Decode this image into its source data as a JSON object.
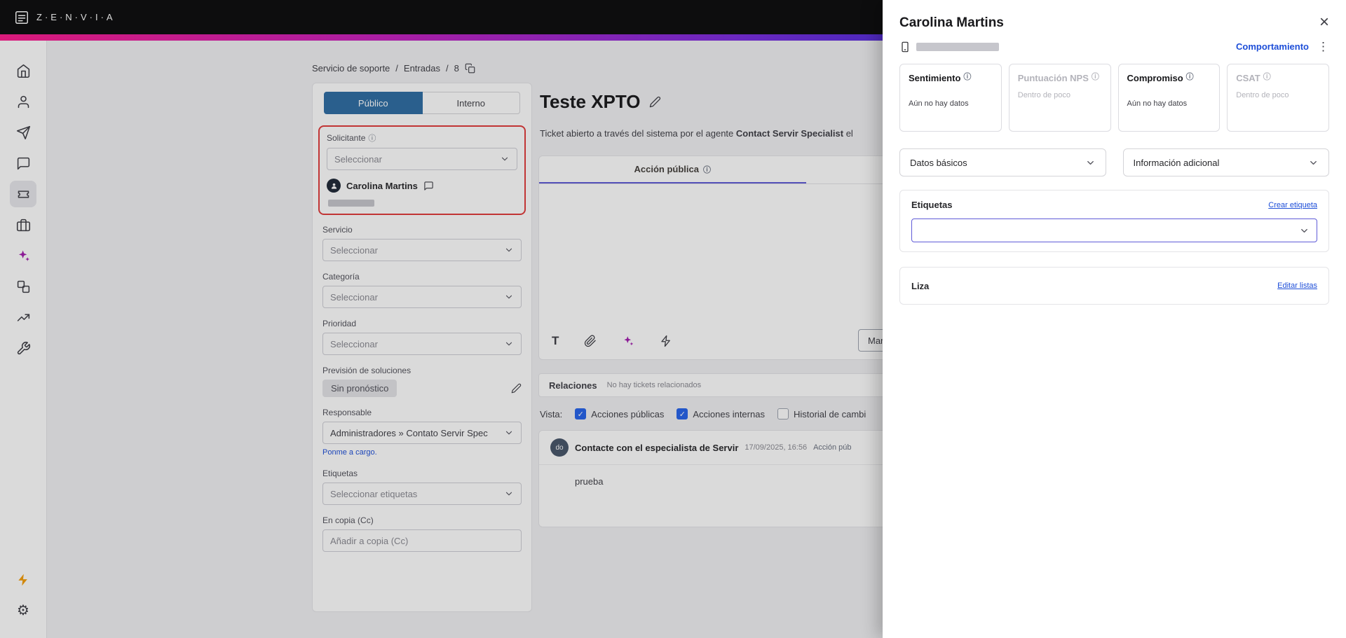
{
  "colors": {
    "brand_gradient": [
      "#ff1b8d",
      "#7a2be0",
      "#2440e8"
    ],
    "active_tab_blue": "#2e6da4",
    "highlight_red": "#e23b3b",
    "link_blue": "#1d4ed8",
    "editor_tab_underline": "#5f5bd7",
    "checkbox_blue": "#2563eb",
    "ai_purple": "#a21caf",
    "bolt_yellow": "#f59e0b"
  },
  "topbar": {
    "logo_text": "Z·E·N·V·I·A"
  },
  "sidebar": {
    "icons": [
      "home",
      "contacts",
      "send",
      "chat",
      "tickets",
      "toolbox",
      "ai-assistant",
      "integrations",
      "analytics",
      "tools",
      "quick-actions",
      "settings"
    ]
  },
  "breadcrumb": {
    "items": [
      "Servicio de soporte",
      "Entradas",
      "8"
    ],
    "separator": "/"
  },
  "form": {
    "tabs": {
      "publico": "Público",
      "interno": "Interno"
    },
    "solicitante": {
      "label": "Solicitante",
      "placeholder": "Seleccionar",
      "contact_name": "Carolina Martins"
    },
    "servicio": {
      "label": "Servicio",
      "placeholder": "Seleccionar"
    },
    "categoria": {
      "label": "Categoría",
      "placeholder": "Seleccionar"
    },
    "prioridad": {
      "label": "Prioridad",
      "placeholder": "Seleccionar"
    },
    "prevision": {
      "label": "Previsión de soluciones",
      "value": "Sin pronóstico"
    },
    "responsable": {
      "label": "Responsable",
      "value": "Administradores » Contato Servir Spec",
      "self_assign": "Ponme a cargo."
    },
    "etiquetas": {
      "label": "Etiquetas",
      "placeholder": "Seleccionar etiquetas"
    },
    "cc": {
      "label": "En copia (Cc)",
      "placeholder": "Añadir a copia (Cc)"
    }
  },
  "ticket": {
    "title": "Teste XPTO",
    "opened_prefix": "Ticket abierto a través del sistema por el agente",
    "opened_agent": "Contact Servir Specialist",
    "opened_suffix": "el",
    "editor_tab": "Acción pública",
    "editor_tools": [
      "text-format",
      "attachment",
      "ai-assistant",
      "quick-reply"
    ],
    "action_button": "Mar",
    "relations_title": "Relaciones",
    "relations_empty": "No hay tickets relacionados",
    "view_label": "Vista:",
    "view_options": [
      {
        "label": "Acciones públicas",
        "checked": true
      },
      {
        "label": "Acciones internas",
        "checked": true
      },
      {
        "label": "Historial de cambi",
        "checked": false
      }
    ],
    "activity": {
      "avatar_initials": "do",
      "author": "Contacte con el especialista de Servir",
      "timestamp": "17/09/2025, 16:56",
      "badge": "Acción púb",
      "body": "prueba"
    }
  },
  "drawer": {
    "title": "Carolina Martins",
    "behavior_link": "Comportamiento",
    "metrics": [
      {
        "label": "Sentimiento",
        "value": "Aún no hay datos",
        "disabled": false
      },
      {
        "label": "Puntuación NPS",
        "value": "Dentro de poco",
        "disabled": true
      },
      {
        "label": "Compromiso",
        "value": "Aún no hay datos",
        "disabled": false
      },
      {
        "label": "CSAT",
        "value": "Dentro de poco",
        "disabled": true
      }
    ],
    "basic_data_label": "Datos básicos",
    "additional_info_label": "Información adicional",
    "tags_title": "Etiquetas",
    "tags_action": "Crear etiqueta",
    "lists_title": "Liza",
    "lists_action": "Editar listas"
  }
}
